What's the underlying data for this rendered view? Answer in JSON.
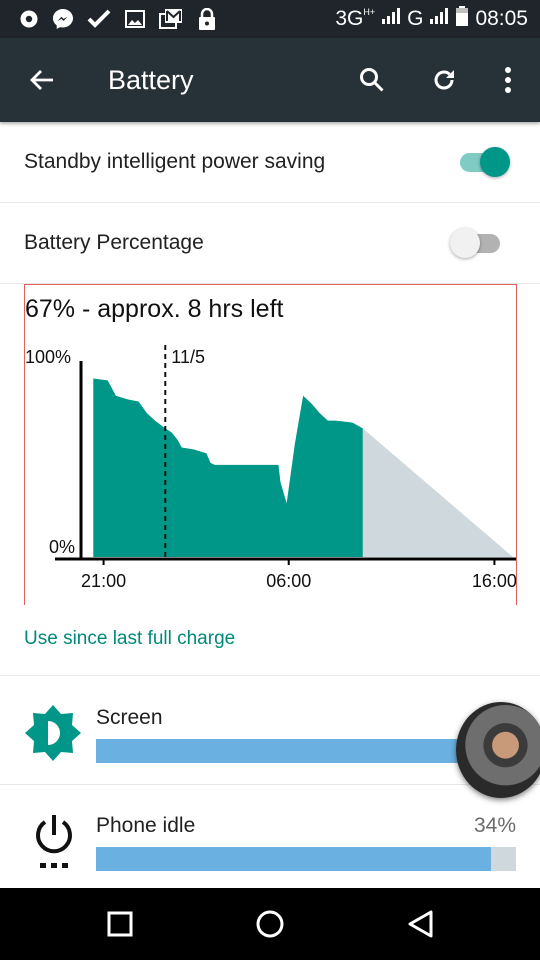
{
  "status_bar": {
    "network_label": "3G",
    "network_sub": "H+",
    "second_network": "G",
    "time": "08:05",
    "left_icons": [
      "radio-icon",
      "messenger-icon",
      "check-icon",
      "image-icon",
      "gmail-icon",
      "lock-icon"
    ]
  },
  "toolbar": {
    "title": "Battery",
    "back_icon": "arrow-left",
    "actions": [
      "search",
      "refresh",
      "more-vert"
    ]
  },
  "settings": {
    "standby_label": "Standby intelligent power saving",
    "standby_on": true,
    "percentage_label": "Battery Percentage",
    "percentage_on": false
  },
  "colors": {
    "accent": "#009688",
    "toolbar": "#263238",
    "statusbar": "#1f252b",
    "prediction": "#cfd8dc",
    "usage_bar": "#6ab0e0",
    "link": "#00897b"
  },
  "chart_data": {
    "type": "area",
    "title": "67% - approx. 8 hrs left",
    "ylabel_top": "100%",
    "ylabel_bottom": "0%",
    "ylim": [
      0,
      100
    ],
    "xlim_hours": [
      0,
      21
    ],
    "x_ticks": [
      {
        "label": "21:00",
        "hour": 1
      },
      {
        "label": "06:00",
        "hour": 10
      },
      {
        "label": "16:00",
        "hour": 20
      }
    ],
    "day_marker": {
      "label": "11/5",
      "hour": 4
    },
    "history": [
      [
        0.5,
        93
      ],
      [
        1.2,
        92
      ],
      [
        1.6,
        84
      ],
      [
        2.2,
        82
      ],
      [
        2.7,
        81
      ],
      [
        3.1,
        75
      ],
      [
        3.5,
        71
      ],
      [
        4.0,
        67
      ],
      [
        4.3,
        65
      ],
      [
        4.6,
        61
      ],
      [
        4.8,
        57
      ],
      [
        5.4,
        56
      ],
      [
        6.0,
        54
      ],
      [
        6.2,
        49
      ],
      [
        6.4,
        48
      ],
      [
        9.5,
        48
      ],
      [
        9.6,
        39
      ],
      [
        9.9,
        28
      ],
      [
        10.3,
        59
      ],
      [
        10.7,
        84
      ],
      [
        11.1,
        80
      ],
      [
        11.5,
        75
      ],
      [
        11.9,
        71
      ],
      [
        12.3,
        71
      ],
      [
        13.1,
        70
      ],
      [
        13.6,
        67
      ]
    ],
    "prediction": [
      [
        13.6,
        67
      ],
      [
        20.9,
        0
      ]
    ]
  },
  "usage": {
    "link_label": "Use since last full charge",
    "items": [
      {
        "name": "Screen",
        "percent": null,
        "fraction": 0.95,
        "icon": "brightness-icon"
      },
      {
        "name": "Phone idle",
        "percent": "34%",
        "fraction": 0.94,
        "icon": "power-idle-icon"
      }
    ]
  },
  "nav": [
    "recents",
    "home",
    "back"
  ]
}
